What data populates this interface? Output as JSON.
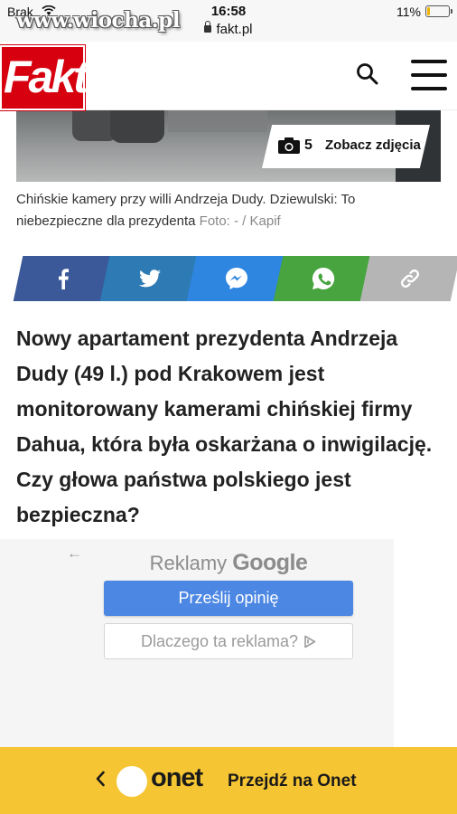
{
  "status_bar": {
    "carrier": "Brak",
    "time": "16:58",
    "url": "fakt.pl",
    "battery": "11%",
    "battery_level": 0.11
  },
  "watermark": "www.wiocha.pl",
  "header": {
    "logo": "Fakt",
    "brand_color": "#d6000f"
  },
  "hero": {
    "gallery_count": "5",
    "gallery_label": "Zobacz zdjęcia"
  },
  "caption": {
    "text": "Chińskie kamery przy willi Andrzeja Dudy. Dziewulski: To niebezpieczne dla prezydenta",
    "credit": "Foto: - / Kapif"
  },
  "share": [
    {
      "name": "facebook",
      "color": "#3b5998"
    },
    {
      "name": "twitter",
      "color": "#2d7ab5"
    },
    {
      "name": "messenger",
      "color": "#2e86e0"
    },
    {
      "name": "whatsapp",
      "color": "#47a43f"
    },
    {
      "name": "copy-link",
      "color": "#b5b5b5"
    }
  ],
  "lead": "Nowy apartament prezydenta Andrzeja Dudy (49 l.) pod Krakowem jest monitorowany kamerami chińskiej firmy Dahua, która była oskarżana o inwigilację. Czy głowa państwa polskiego jest bezpieczna?",
  "ad": {
    "back_icon": "←",
    "header_prefix": "Reklamy",
    "header_brand": "Google",
    "feedback_button": "Prześlij opinię",
    "why_button": "Dlaczego ta reklama?"
  },
  "onet_bar": {
    "logo": "onet",
    "link": "Przejdź na Onet",
    "background": "#f5c533"
  }
}
